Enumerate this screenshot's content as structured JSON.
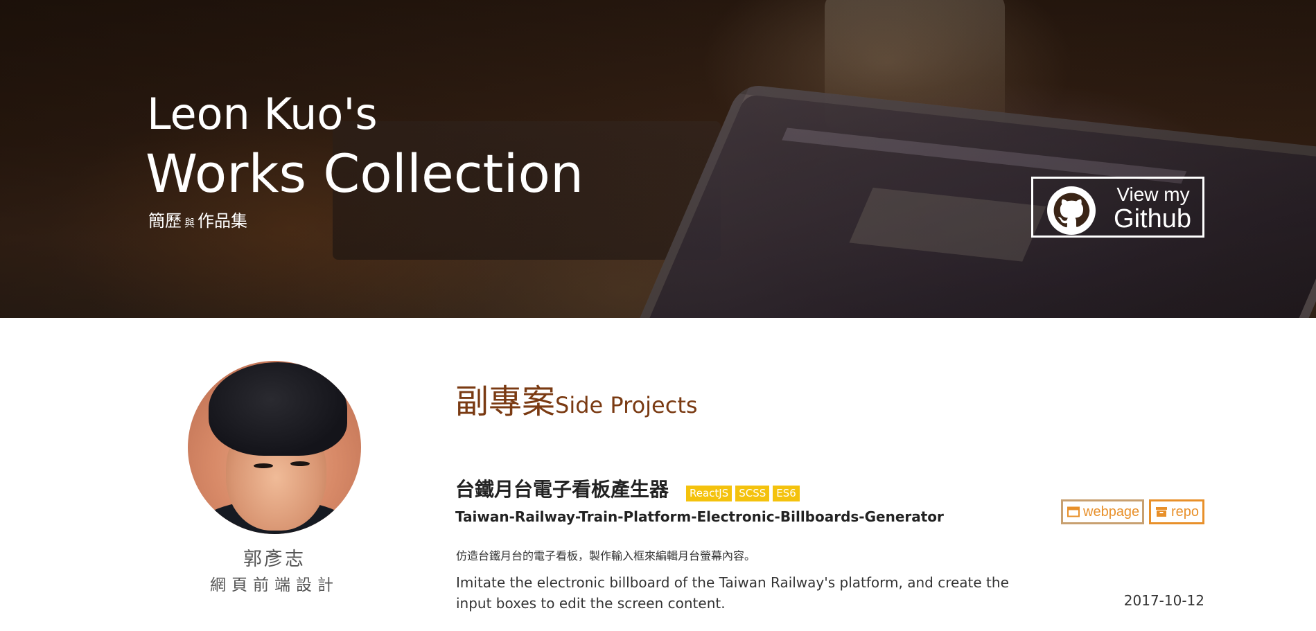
{
  "hero": {
    "title_line1": "Leon Kuo's",
    "title_line2": "Works Collection",
    "subtitle_part1": "簡歷",
    "subtitle_connector": "與",
    "subtitle_part2": "作品集",
    "github_button": {
      "line1": "View my",
      "line2": "Github",
      "icon": "github-icon"
    }
  },
  "profile": {
    "name": "郭彥志",
    "role": "網頁前端設計"
  },
  "section": {
    "title_zh": "副專案",
    "title_en": "Side Projects"
  },
  "project": {
    "title_zh": "台鐵月台電子看板產生器",
    "tags": [
      "ReactJS",
      "SCSS",
      "ES6"
    ],
    "title_en": "Taiwan-Railway-Train-Platform-Electronic-Billboards-Generator",
    "description_zh": "仿造台鐵月台的電子看板，製作輸入框來編輯月台螢幕內容。",
    "description_en": "Imitate the electronic billboard of the Taiwan Railway's platform, and create the input boxes to edit the screen content.",
    "links": {
      "webpage_label": "webpage",
      "webpage_icon": "browser-window-icon",
      "repo_label": "repo",
      "repo_icon": "archive-box-icon"
    },
    "date": "2017-10-12"
  },
  "colors": {
    "section_title": "#7a3a12",
    "tag_background": "#f4c20d",
    "link_accent": "#e8902a"
  }
}
